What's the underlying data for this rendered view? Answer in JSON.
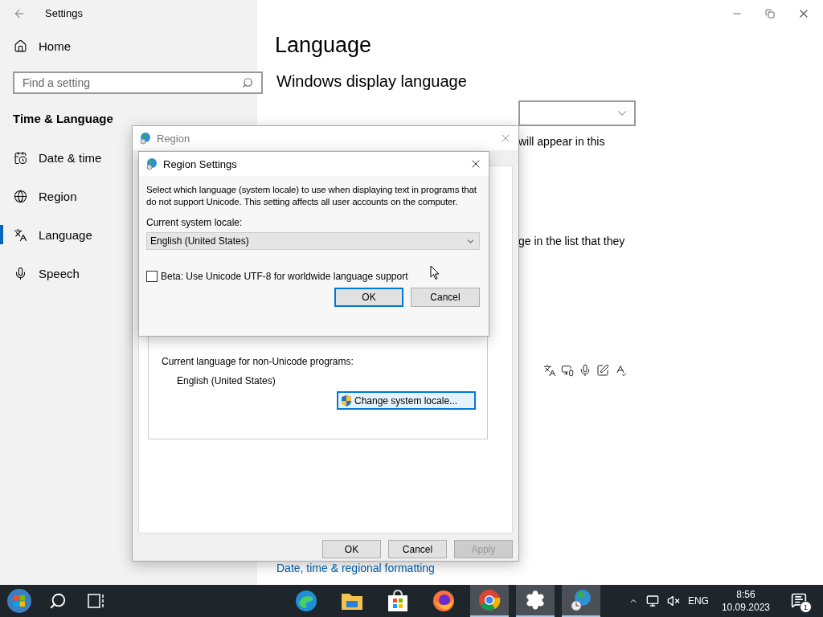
{
  "settings_window": {
    "title": "Settings",
    "sidebar": {
      "home": "Home",
      "search": {
        "placeholder": "Find a setting"
      },
      "section": "Time & Language",
      "items": [
        {
          "kind": "clock",
          "label": "Date & time",
          "selected": false
        },
        {
          "kind": "globe",
          "label": "Region",
          "selected": false
        },
        {
          "kind": "language",
          "label": "Language",
          "selected": true
        },
        {
          "kind": "mic",
          "label": "Speech",
          "selected": false
        }
      ]
    },
    "page": {
      "title": "Language",
      "heading": "Windows display language",
      "text_1": "will appear in this",
      "text_2": "ge in the list that they",
      "link": "Date, time & regional formatting"
    }
  },
  "region_window": {
    "title": "Region",
    "group": {
      "label": "Current language for non-Unicode programs:",
      "value": "English (United States)",
      "button": "Change system locale..."
    },
    "buttons": [
      {
        "label": "OK",
        "disabled": false
      },
      {
        "label": "Cancel",
        "disabled": false
      },
      {
        "label": "Apply",
        "disabled": true
      }
    ]
  },
  "region_settings_dialog": {
    "title": "Region Settings",
    "description": "Select which language (system locale) to use when displaying text in programs that do not support Unicode. This setting affects all user accounts on the computer.",
    "locale_label": "Current system locale:",
    "locale": "English (United States)",
    "beta": {
      "label": "Beta: Use Unicode UTF-8 for worldwide language support",
      "checked": false
    },
    "buttons": [
      {
        "label": "OK",
        "default": true
      },
      {
        "label": "Cancel",
        "default": false
      }
    ]
  },
  "taskbar": {
    "apps": [
      {
        "kind": "edge",
        "active": false
      },
      {
        "kind": "explorer",
        "active": false
      },
      {
        "kind": "store",
        "active": false
      },
      {
        "kind": "firefox",
        "active": false
      },
      {
        "kind": "chrome",
        "active": true
      },
      {
        "kind": "settings",
        "active": true
      },
      {
        "kind": "region",
        "active": true
      }
    ],
    "language": "ENG",
    "time": "8:56",
    "date": "10.09.2023",
    "notifications": "1"
  }
}
